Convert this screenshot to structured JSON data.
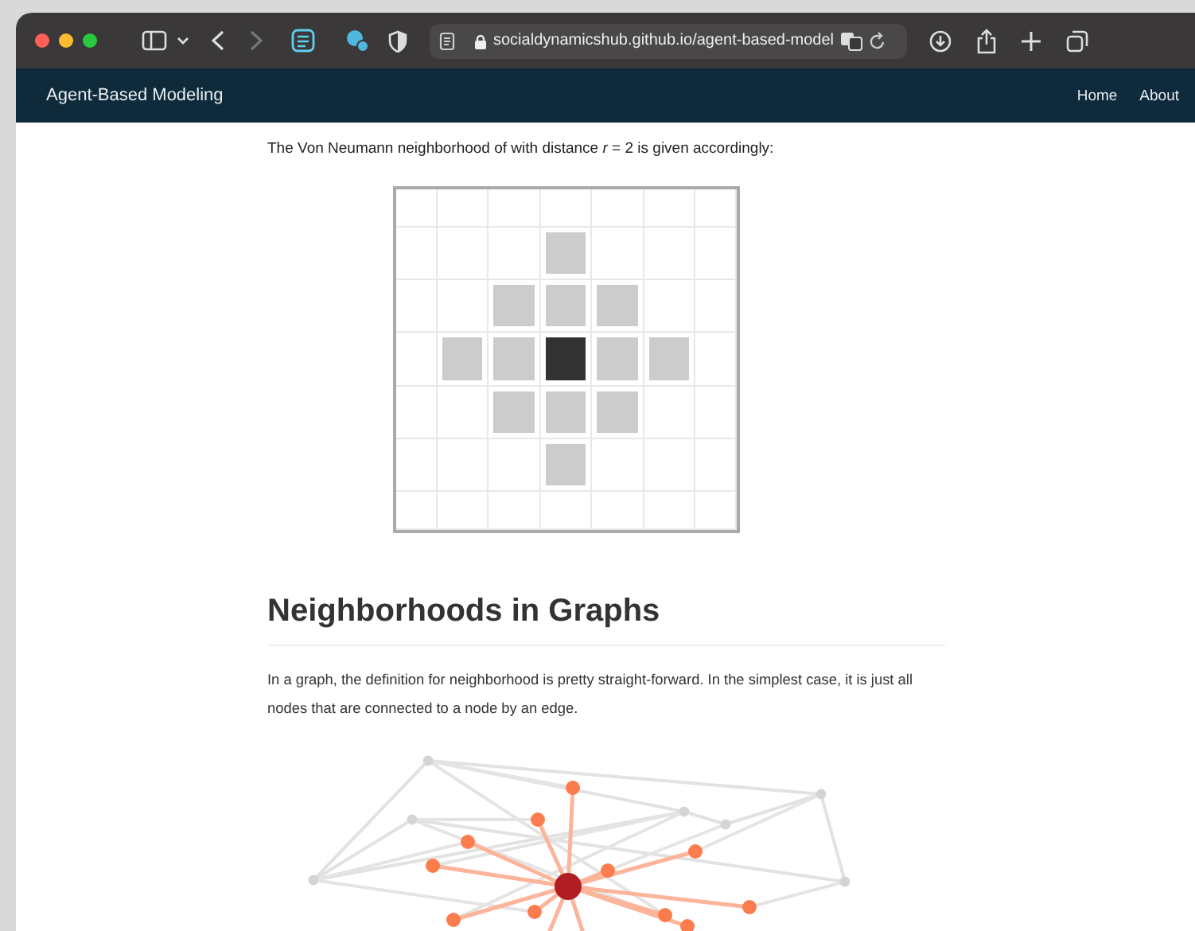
{
  "browser": {
    "url": "socialdynamicshub.github.io/agent-based-model"
  },
  "navbar": {
    "brand": "Agent-Based Modeling",
    "links": [
      "Home",
      "About"
    ]
  },
  "intro": "The Von Neumann neighborhood of with distance *r* = 2 is given accordingly:",
  "grid": [
    [
      {
        "kind": "empty"
      },
      {
        "kind": "empty"
      },
      {
        "kind": "empty"
      },
      {
        "kind": "empty"
      },
      {
        "kind": "empty"
      },
      {
        "kind": "empty"
      },
      {
        "kind": "empty"
      }
    ],
    [
      {
        "kind": "empty"
      },
      {
        "kind": "empty"
      },
      {
        "kind": "empty"
      },
      {
        "kind": "neighbor"
      },
      {
        "kind": "empty"
      },
      {
        "kind": "empty"
      },
      {
        "kind": "empty"
      }
    ],
    [
      {
        "kind": "empty"
      },
      {
        "kind": "empty"
      },
      {
        "kind": "neighbor"
      },
      {
        "kind": "neighbor"
      },
      {
        "kind": "neighbor"
      },
      {
        "kind": "empty"
      },
      {
        "kind": "empty"
      }
    ],
    [
      {
        "kind": "empty"
      },
      {
        "kind": "neighbor"
      },
      {
        "kind": "neighbor"
      },
      {
        "kind": "center"
      },
      {
        "kind": "neighbor"
      },
      {
        "kind": "neighbor"
      },
      {
        "kind": "empty"
      }
    ],
    [
      {
        "kind": "empty"
      },
      {
        "kind": "empty"
      },
      {
        "kind": "neighbor"
      },
      {
        "kind": "neighbor"
      },
      {
        "kind": "neighbor"
      },
      {
        "kind": "empty"
      },
      {
        "kind": "empty"
      }
    ],
    [
      {
        "kind": "empty"
      },
      {
        "kind": "empty"
      },
      {
        "kind": "empty"
      },
      {
        "kind": "neighbor"
      },
      {
        "kind": "empty"
      },
      {
        "kind": "empty"
      },
      {
        "kind": "empty"
      }
    ],
    [
      {
        "kind": "empty"
      },
      {
        "kind": "empty"
      },
      {
        "kind": "empty"
      },
      {
        "kind": "empty"
      },
      {
        "kind": "empty"
      },
      {
        "kind": "empty"
      },
      {
        "kind": "empty"
      }
    ]
  ],
  "heading": "Neighborhoods in Graphs",
  "paragraph": "In a graph, the definition for neighborhood is pretty straight-forward. In the simplest case, it is just all nodes that are connected to a node by an edge."
}
